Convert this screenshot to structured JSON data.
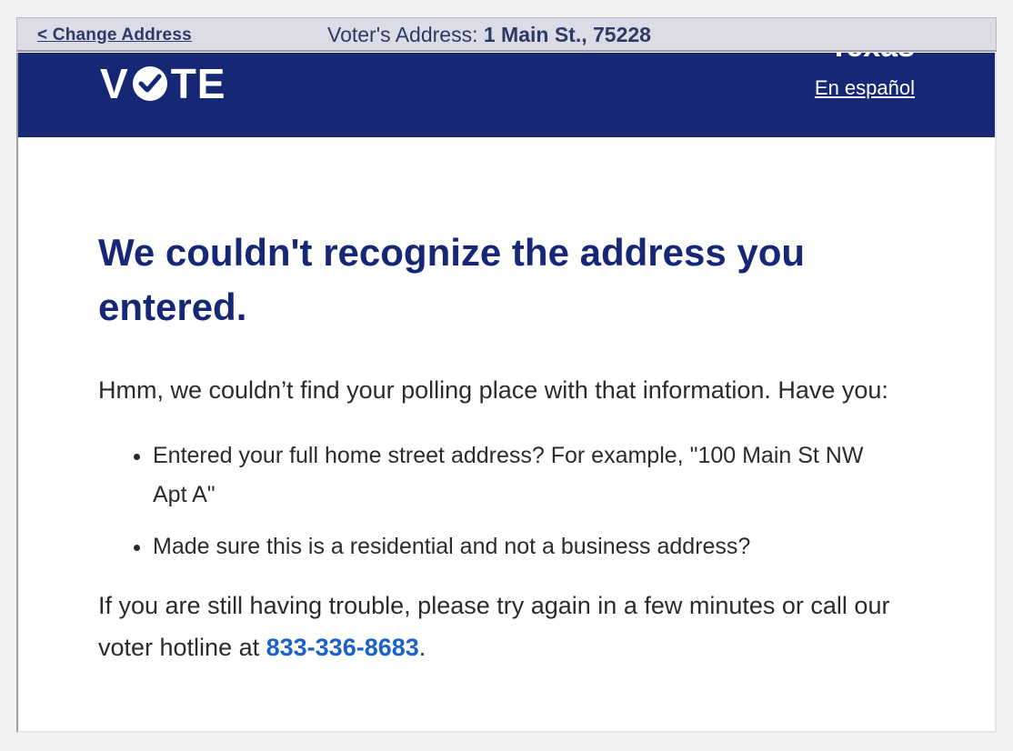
{
  "topbar": {
    "change_address": "< Change Address",
    "address_label": "Voter's Address: ",
    "address_value": "1 Main St., 75228"
  },
  "header": {
    "logo_text_left": "V",
    "logo_text_right": "TE",
    "state_partial": "Texas",
    "language_link": "En español",
    "bg_color": "#162776"
  },
  "main": {
    "title": "We couldn't recognize the address you entered.",
    "intro": "Hmm, we couldn’t find your polling place with that information. Have you:",
    "bullets": [
      "Entered your full home street address? For example, \"100 Main St NW Apt A\"",
      "Made sure this is a residential and not a business address?"
    ],
    "outro_before": "If you are still having trouble, please try again in a few minutes or call our voter hotline at ",
    "phone": "833-336-8683",
    "outro_after": "."
  },
  "colors": {
    "title": "#162776",
    "link": "#1b61c8"
  }
}
